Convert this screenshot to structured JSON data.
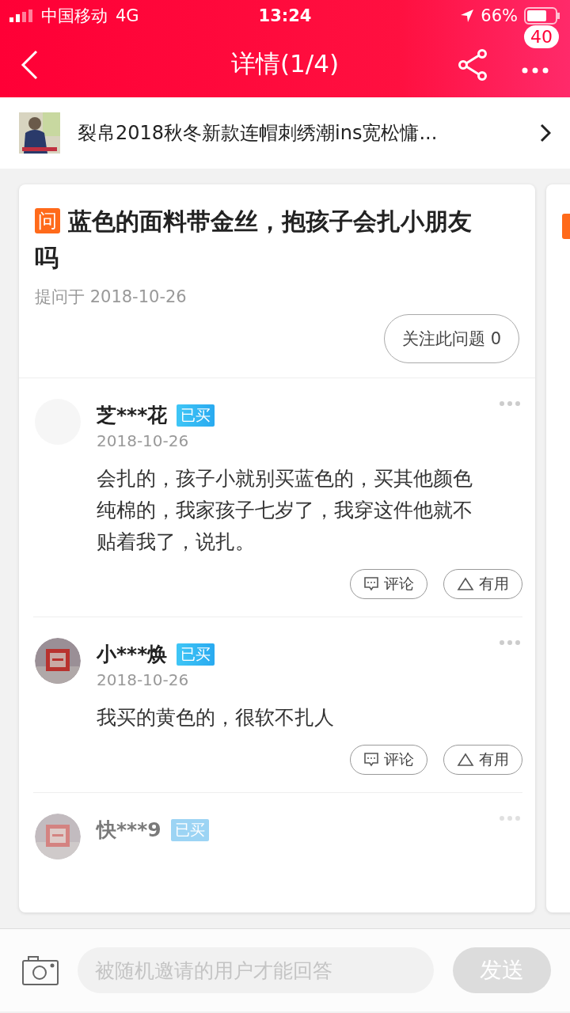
{
  "status_bar": {
    "carrier": "中国移动",
    "network": "4G",
    "time": "13:24",
    "battery": "66%"
  },
  "header": {
    "title": "详情(1/4)",
    "badge": "40"
  },
  "product": {
    "title": "裂帛2018秋冬新款连帽刺绣潮ins宽松慵..."
  },
  "question": {
    "tag": "问",
    "text": "蓝色的面料带金丝，抱孩子会扎小朋友吗",
    "date": "提问于 2018-10-26",
    "follow": "关注此问题 0"
  },
  "answers": [
    {
      "avatar": {
        "kind": "blank"
      },
      "name": "芝***花",
      "badge": "已买",
      "date": "2018-10-26",
      "text": "会扎的，孩子小就别买蓝色的，买其他颜色纯棉的，我家孩子七岁了，我穿这件他就不贴着我了，说扎。",
      "comment": "评论",
      "useful": "有用",
      "faded": false
    },
    {
      "name": "小***焕",
      "badge": "已买",
      "date": "2018-10-26",
      "text": "我买的黄色的，很软不扎人",
      "comment": "评论",
      "useful": "有用",
      "faded": false
    },
    {
      "name": "快***9",
      "badge": "已买",
      "faded": true
    }
  ],
  "composer": {
    "placeholder": "被随机邀请的用户才能回答",
    "send": "发送"
  }
}
